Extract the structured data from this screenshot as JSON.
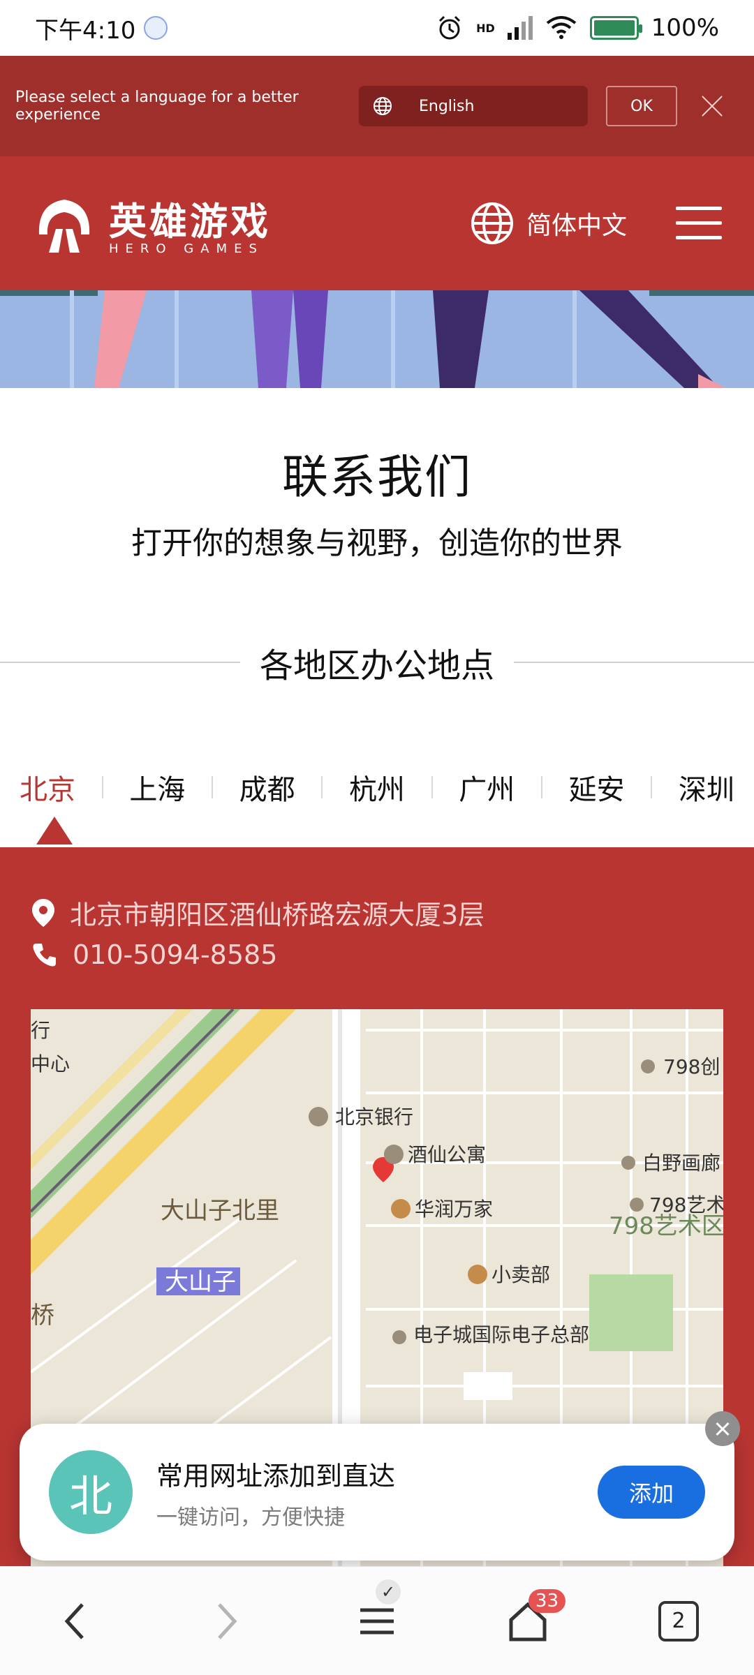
{
  "status_bar": {
    "time": "下午4:10",
    "signal_label": "HD",
    "battery": "100%"
  },
  "language_banner": {
    "message": "Please select a language for a better experience",
    "selected_language": "English",
    "ok_label": "OK"
  },
  "header": {
    "logo_cn": "英雄游戏",
    "logo_en": "HERO GAMES",
    "language_label": "简体中文"
  },
  "contact": {
    "title": "联系我们",
    "subtitle": "打开你的想象与视野，创造你的世界",
    "offices_title": "各地区办公地点"
  },
  "tabs": [
    "北京",
    "上海",
    "成都",
    "杭州",
    "广州",
    "延安",
    "深圳"
  ],
  "office": {
    "address": "北京市朝阳区酒仙桥路宏源大厦3层",
    "phone": "010-5094-8585"
  },
  "map": {
    "labels": {
      "bank": "北京银行",
      "apartment": "酒仙公寓",
      "mall": "华润万家",
      "shop": "小卖部",
      "electronics": "电子城国际电子总部",
      "district_north": "大山子北里",
      "district": "大山子",
      "art_zone": "798艺术区",
      "art_798_top": "798创",
      "gallery": "白野画廊",
      "art_798": "798艺术",
      "bridge": "桥",
      "center": "中心",
      "road_top": "行"
    }
  },
  "toast": {
    "avatar_char": "北",
    "title": "常用网址添加到直达",
    "subtitle": "一键访问，方便快捷",
    "add_label": "添加"
  },
  "bottom_nav": {
    "badge": "33",
    "tabs_count": "2"
  },
  "colors": {
    "brand_red": "#b93532",
    "banner_red": "#9e2f2b",
    "add_blue": "#1a6fe0"
  }
}
